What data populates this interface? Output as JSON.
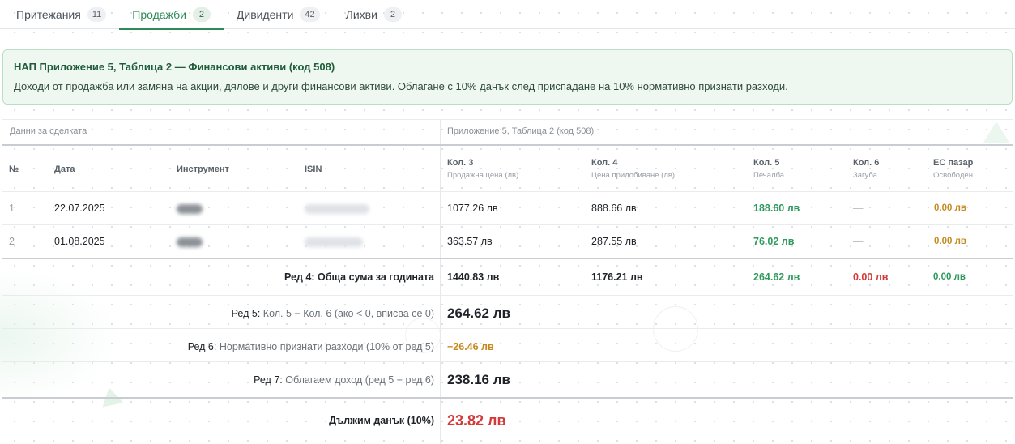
{
  "tabs": [
    {
      "label": "Притежания",
      "count": "11"
    },
    {
      "label": "Продажби",
      "count": "2"
    },
    {
      "label": "Дивиденти",
      "count": "42"
    },
    {
      "label": "Лихви",
      "count": "2"
    }
  ],
  "banner": {
    "title": "НАП Приложение 5, Таблица 2 — Финансови активи (код 508)",
    "text": "Доходи от продажба или замяна на акции, дялове и други финансови активи. Облагане с 10% данък след приспадане на 10% нормативно признати разходи."
  },
  "table": {
    "group_left": "Данни за сделката",
    "group_right": "Приложение 5, Таблица 2 (код 508)",
    "headers": {
      "no": "№",
      "date": "Дата",
      "instrument": "Инструмент",
      "isin": "ISIN",
      "col3": {
        "title": "Кол. 3",
        "sub": "Продажна цена (лв)"
      },
      "col4": {
        "title": "Кол. 4",
        "sub": "Цена придобиване (лв)"
      },
      "col5": {
        "title": "Кол. 5",
        "sub": "Печалба"
      },
      "col6": {
        "title": "Кол. 6",
        "sub": "Загуба"
      },
      "eu": {
        "title": "ЕС пазар",
        "sub": "Освободен"
      }
    },
    "rows": [
      {
        "no": "1",
        "date": "22.07.2025",
        "col3": "1077.26 лв",
        "col4": "888.66 лв",
        "col5": "188.60 лв",
        "col6": "—",
        "eu": "0.00 лв"
      },
      {
        "no": "2",
        "date": "01.08.2025",
        "col3": "363.57 лв",
        "col4": "287.55 лв",
        "col5": "76.02 лв",
        "col6": "—",
        "eu": "0.00 лв"
      }
    ],
    "totals": {
      "label": "Ред 4: Обща сума за годината",
      "col3": "1440.83 лв",
      "col4": "1176.21 лв",
      "col5": "264.62 лв",
      "col6": "0.00 лв",
      "eu": "0.00 лв"
    },
    "row5": {
      "prefix": "Ред 5:",
      "text": "Кол. 5 − Кол. 6 (ако < 0, вписва се 0)",
      "value": "264.62 лв"
    },
    "row6": {
      "prefix": "Ред 6:",
      "text": "Нормативно признати разходи (10% от ред 5)",
      "value": "−26.46 лв"
    },
    "row7": {
      "prefix": "Ред 7:",
      "text": "Облагаем доход (ред 5 − ред 6)",
      "value": "238.16 лв"
    },
    "tax": {
      "label": "Дължим данък (10%)",
      "value": "23.82 лв"
    }
  },
  "colors": {
    "accent": "#2e8a57",
    "profit": "#2f9a5d",
    "loss": "#d23a3a",
    "neutral_value": "#c58a1e",
    "banner_bg": "#eef8f1"
  }
}
